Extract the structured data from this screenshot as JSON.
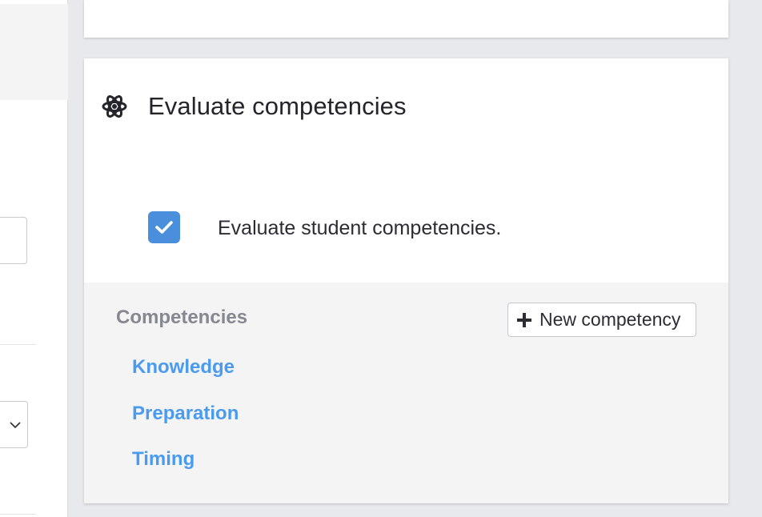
{
  "card": {
    "title": "Evaluate competencies",
    "icon": "atom-icon"
  },
  "evaluate_checkbox": {
    "checked": true,
    "label": "Evaluate student competencies."
  },
  "competencies": {
    "heading": "Competencies",
    "new_button_label": "New competency",
    "items": [
      {
        "label": "Knowledge"
      },
      {
        "label": "Preparation"
      },
      {
        "label": "Timing"
      }
    ]
  },
  "colors": {
    "accent_blue": "#4a8fdb",
    "link_blue": "#4a9bef",
    "heading_gray": "#858891",
    "section_bg": "#f4f4f5",
    "page_bg": "#e8e9ed"
  }
}
